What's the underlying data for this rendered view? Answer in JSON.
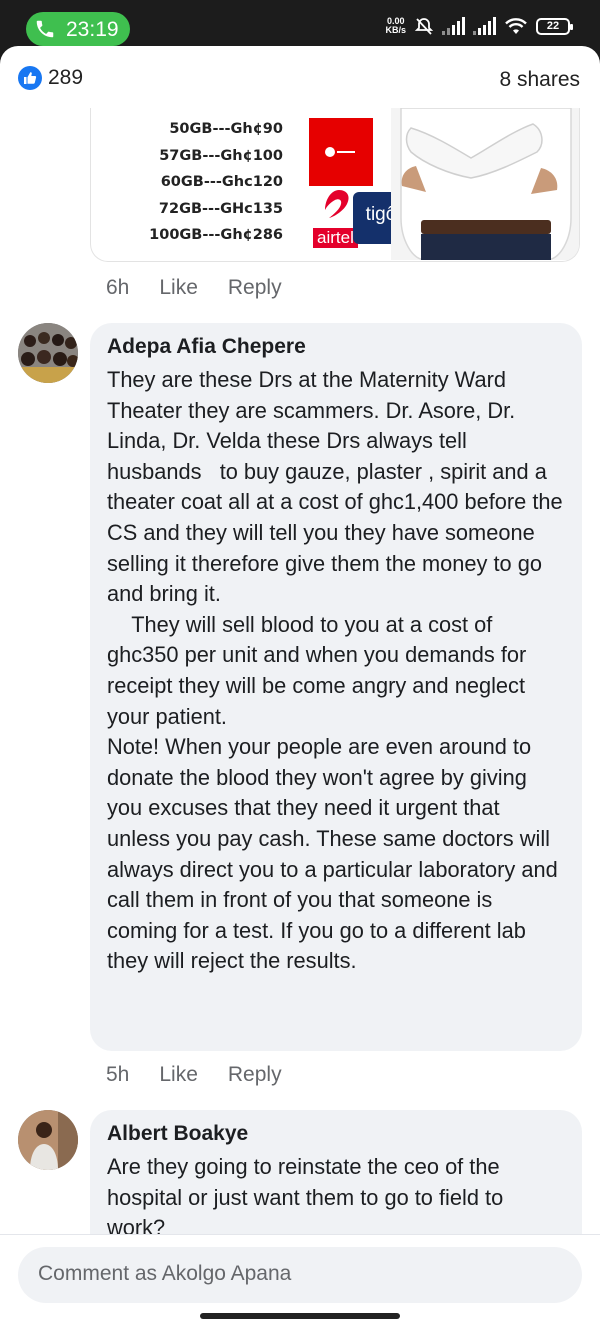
{
  "status_bar": {
    "time": "23:19",
    "net_speed_value": "0.00",
    "net_speed_unit": "KB/s",
    "battery": "22",
    "icons": [
      "phone-call-icon",
      "mute-icon",
      "signal-icon",
      "signal-icon",
      "wifi-icon",
      "battery-icon"
    ]
  },
  "post": {
    "reaction_count": "289",
    "shares": "8 shares"
  },
  "ad_image": {
    "prices": [
      "50GB---Gh¢90",
      "57GB---Gh¢100",
      "60GB---Ghc120",
      "72GB---GHc135",
      "100GB---Gh¢286"
    ],
    "brand_tigo": "tigô",
    "brand_airtel": "airtel"
  },
  "comments": [
    {
      "time": "6h",
      "like": "Like",
      "reply": "Reply"
    },
    {
      "author": "Adepa Afia Chepere",
      "text": "They are these Drs at the Maternity Ward Theater they are scammers. Dr. Asore, Dr. Linda, Dr. Velda these Drs always tell husbands   to buy gauze, plaster , spirit and a theater coat all at a cost of ghc1,400 before the CS and they will tell you they have someone selling it therefore give them the money to go and bring it.\n    They will sell blood to you at a cost of ghc350 per unit and when you demands for receipt they will be come angry and neglect your patient.\nNote! When your people are even around to donate the blood they won't agree by giving you excuses that they need it urgent that unless you pay cash. These same doctors will always direct you to a particular laboratory and call them in front of you that someone is coming for a test. If you go to a different lab they will reject the results.",
      "time": "5h",
      "like": "Like",
      "reply": "Reply"
    },
    {
      "author": "Albert Boakye",
      "text": "Are they going to reinstate the ceo of the hospital or just want them to go to field to work?"
    }
  ],
  "composer": {
    "placeholder": "Comment as Akolgo Apana"
  },
  "colors": {
    "like_blue": "#1877f2",
    "call_green": "#3fbf4f",
    "bubble_gray": "#f0f2f5",
    "meta_gray": "#65676b"
  }
}
